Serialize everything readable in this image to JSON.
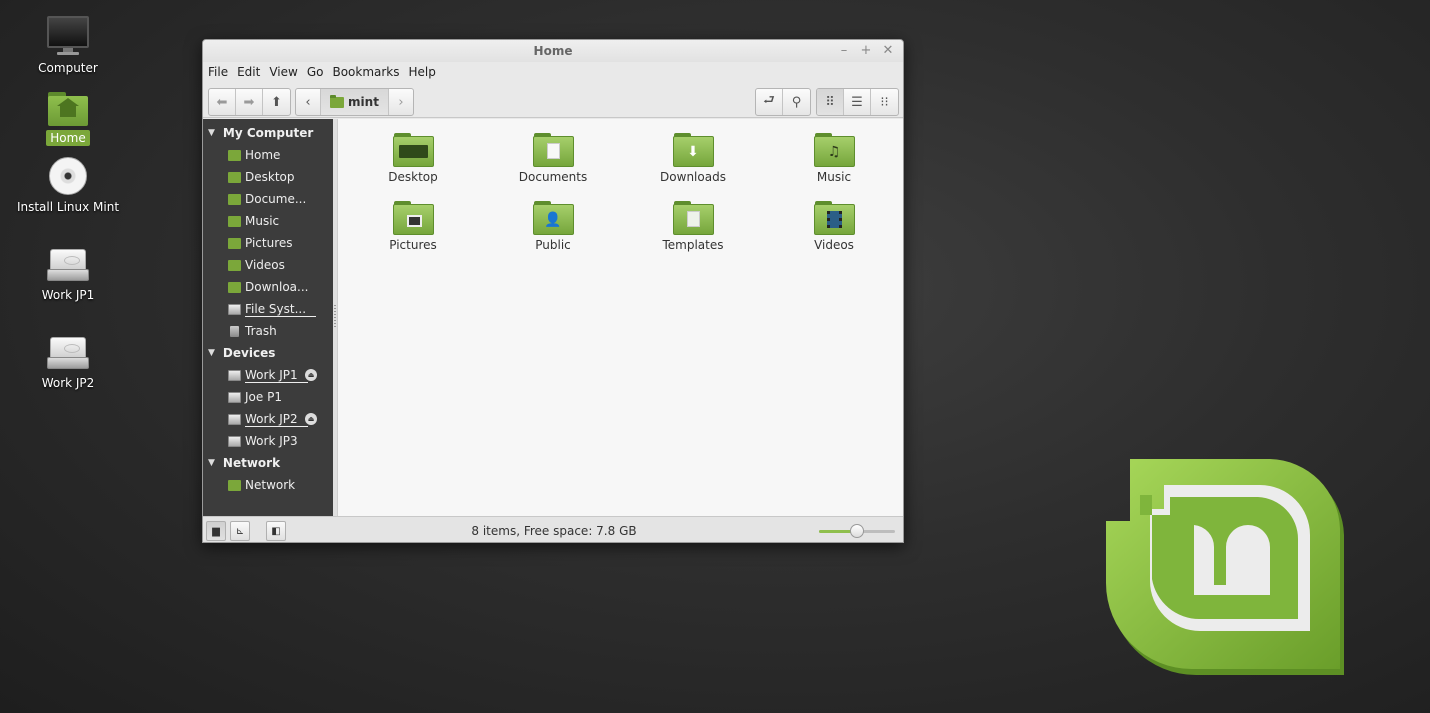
{
  "desktop": {
    "icons": [
      {
        "label": "Computer"
      },
      {
        "label": "Home"
      },
      {
        "label": "Install Linux Mint"
      },
      {
        "label": "Work JP1"
      },
      {
        "label": "Work JP2"
      }
    ]
  },
  "window": {
    "title": "Home",
    "controls": {
      "minimize": "–",
      "maximize": "+",
      "close": "✕"
    }
  },
  "menu": [
    "File",
    "Edit",
    "View",
    "Go",
    "Bookmarks",
    "Help"
  ],
  "toolbar": {
    "back": "⬅",
    "forward": "➡",
    "up": "⬆",
    "path_toggle": "‹",
    "location": "mint",
    "next": "›",
    "terminal": "⮐",
    "search": "⚲",
    "view_icons": "⠿",
    "view_list": "☰",
    "view_compact": "⁝⁝"
  },
  "sidebar": {
    "sections": [
      {
        "title": "My Computer",
        "items": [
          "Home",
          "Desktop",
          "Docume...",
          "Music",
          "Pictures",
          "Videos",
          "Downloa...",
          "File Syst...",
          "Trash"
        ]
      },
      {
        "title": "Devices",
        "items": [
          "Work JP1",
          "Joe P1",
          "Work JP2",
          "Work JP3"
        ]
      },
      {
        "title": "Network",
        "items": [
          "Network"
        ]
      }
    ],
    "eject_glyph": "⏏"
  },
  "files": [
    {
      "name": "Desktop"
    },
    {
      "name": "Documents"
    },
    {
      "name": "Downloads"
    },
    {
      "name": "Music"
    },
    {
      "name": "Pictures"
    },
    {
      "name": "Public"
    },
    {
      "name": "Templates"
    },
    {
      "name": "Videos"
    }
  ],
  "statusbar": {
    "text": "8 items, Free space: 7.8 GB",
    "zoom_level": 0.5,
    "btn_places": "▆",
    "btn_tree": "⊾",
    "btn_toggle": "◧"
  },
  "colors": {
    "accent": "#7ba73a",
    "sidebar_bg": "#3c3c3c",
    "content_bg": "#f7f7f7"
  }
}
